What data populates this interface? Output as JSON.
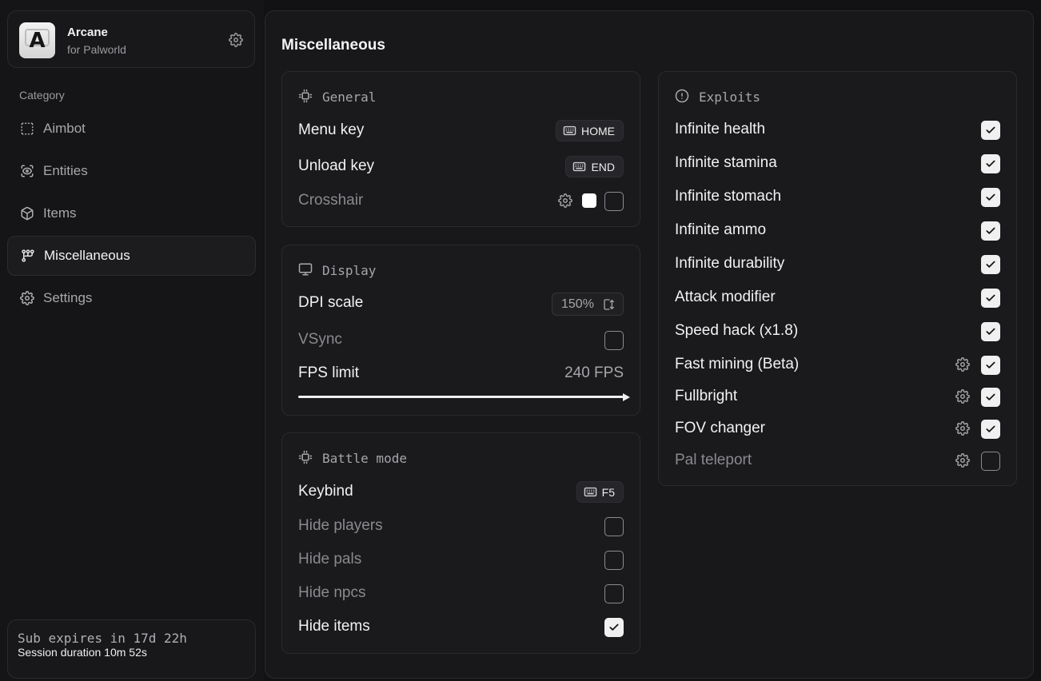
{
  "brand": {
    "name": "Arcane",
    "subtitle": "for Palworld",
    "logo_letter": "A"
  },
  "sidebar": {
    "category_label": "Category",
    "items": [
      {
        "label": "Aimbot",
        "icon": "dashed-square-icon"
      },
      {
        "label": "Entities",
        "icon": "scan-eye-icon"
      },
      {
        "label": "Items",
        "icon": "box-icon"
      },
      {
        "label": "Miscellaneous",
        "icon": "git-fork-icon",
        "active": true
      },
      {
        "label": "Settings",
        "icon": "gear-icon"
      }
    ]
  },
  "subscription": {
    "expires": "Sub expires in 17d 22h",
    "session": "Session duration 10m 52s"
  },
  "main": {
    "title": "Miscellaneous",
    "general": {
      "title": "General",
      "menu_key": {
        "label": "Menu key",
        "key": "HOME"
      },
      "unload_key": {
        "label": "Unload key",
        "key": "END"
      },
      "crosshair": {
        "label": "Crosshair",
        "checked": false,
        "color": "#ffffff"
      }
    },
    "display": {
      "title": "Display",
      "dpi": {
        "label": "DPI scale",
        "value": "150%"
      },
      "vsync": {
        "label": "VSync",
        "checked": false
      },
      "fps": {
        "label": "FPS limit",
        "value": "240 FPS",
        "fill_fraction": 1.0
      }
    },
    "battle": {
      "title": "Battle mode",
      "keybind": {
        "label": "Keybind",
        "key": "F5"
      },
      "hide_players": {
        "label": "Hide players",
        "checked": false
      },
      "hide_pals": {
        "label": "Hide pals",
        "checked": false
      },
      "hide_npcs": {
        "label": "Hide npcs",
        "checked": false
      },
      "hide_items": {
        "label": "Hide items",
        "checked": true
      }
    },
    "exploits": {
      "title": "Exploits",
      "items": [
        {
          "label": "Infinite health",
          "checked": true
        },
        {
          "label": "Infinite stamina",
          "checked": true
        },
        {
          "label": "Infinite stomach",
          "checked": true
        },
        {
          "label": "Infinite ammo",
          "checked": true
        },
        {
          "label": "Infinite durability",
          "checked": true
        },
        {
          "label": "Attack modifier",
          "checked": true
        },
        {
          "label": "Speed hack (x1.8)",
          "checked": true
        },
        {
          "label": "Fast mining (Beta)",
          "checked": true,
          "has_settings": true
        },
        {
          "label": "Fullbright",
          "checked": true,
          "has_settings": true
        },
        {
          "label": "FOV changer",
          "checked": true,
          "has_settings": true
        },
        {
          "label": "Pal teleport",
          "checked": false,
          "has_settings": true
        }
      ]
    }
  },
  "colors": {
    "background": "#121214",
    "panel": "#18181b",
    "accent": "#f0f0f0",
    "muted_text": "#8a8a8e"
  }
}
